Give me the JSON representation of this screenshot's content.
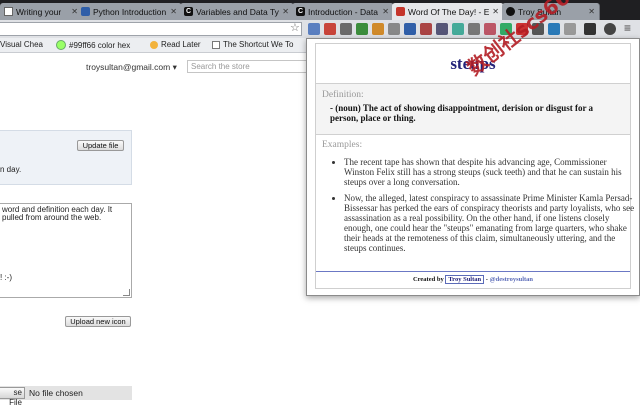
{
  "browser": {
    "tabs": [
      {
        "label": "Writing your",
        "icon": "document-icon"
      },
      {
        "label": "Python Introduction -",
        "icon": "python-icon"
      },
      {
        "label": "Variables and Data Typ",
        "icon": "codecademy-icon"
      },
      {
        "label": "Introduction - Data M",
        "icon": "codecademy-icon"
      },
      {
        "label": "Word Of The Day! - Ed",
        "icon": "chrome-store-icon"
      },
      {
        "label": "Troy Sultan",
        "icon": "github-icon"
      }
    ],
    "bookmarks": [
      {
        "label": "Visual Chea",
        "icon": "bookmark-icon"
      },
      {
        "label": "#99ff66 color hex",
        "icon": "color-icon"
      },
      {
        "label": "Read Later",
        "icon": "read-later-icon"
      },
      {
        "label": "The Shortcut We To",
        "icon": "page-icon"
      }
    ]
  },
  "store": {
    "email": "troysultan@gmail.com ▾",
    "search_placeholder": "Search the store",
    "update_file_label": "Update file",
    "fragment_day": "n day.",
    "desc_line1": "word and definition each day. It",
    "desc_line2": "pulled from around the web.",
    "desc_line3": "! :-)",
    "upload_icon_label": "Upload new icon",
    "choose_file_label": "se File",
    "no_file_label": "No file chosen"
  },
  "popup": {
    "word": "steups",
    "definition_label": "Definition:",
    "definition_text": "- (noun) The act of showing disappointment, derision or disgust for a person, place or thing.",
    "examples_label": "Examples:",
    "examples": [
      "The recent tape has shown that despite his advancing age, Commissioner Winston Felix still has a strong steups (suck teeth) and that he can sustain his steups over a long conversation.",
      "Now, the alleged, latest conspiracy to assassinate Prime Minister Kamla Persad-Bissessar has perked the ears of conspiracy theorists and party loyalists, who see assassination as a real possibility. On the other hand, if one listens closely enough, one could hear the \"steups\" emanating from large quarters, who shake their heads at the remoteness of this claim, simultaneously uttering, and the steups continues."
    ],
    "footer_prefix": "Created by",
    "footer_author": "Troy Sultan",
    "footer_sep": " - ",
    "footer_handle": "@destroysultan",
    "watermark": "数创社scs66"
  },
  "colors": {
    "word_color": "#23237a",
    "watermark_color": "#b31d24",
    "footer_rule": "#6b78c4"
  }
}
